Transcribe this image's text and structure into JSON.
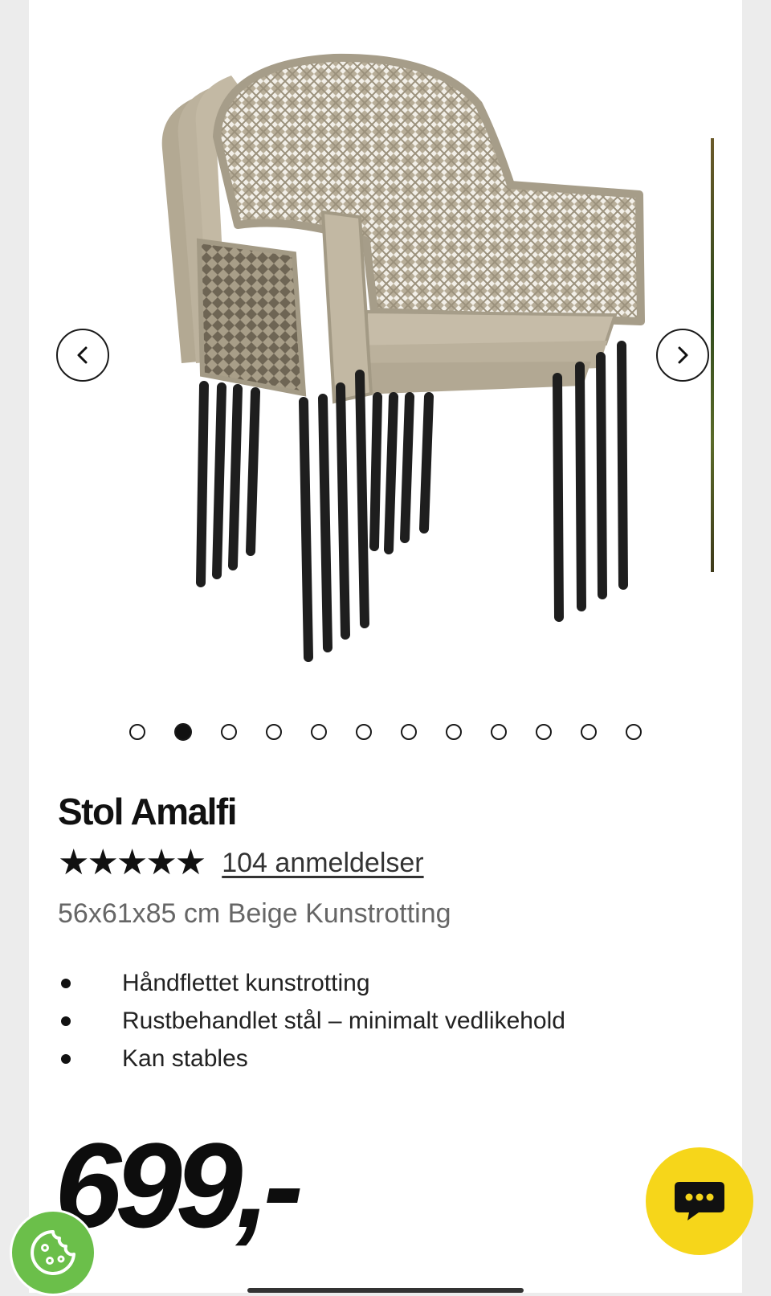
{
  "product": {
    "title": "Stol Amalfi",
    "rating_stars": "★★★★★",
    "rating_value": 5,
    "reviews_label": "104 anmeldelser",
    "subtitle": "56x61x85 cm Beige Kunstrotting",
    "features": [
      "Håndflettet kunstrotting",
      "Rustbehandlet stål – minimalt vedlikehold",
      "Kan stables"
    ],
    "price": "699,-"
  },
  "gallery": {
    "image_count": 12,
    "active_index": 2,
    "icons": {
      "prev": "chevron-left-icon",
      "next": "chevron-right-icon"
    }
  },
  "floating": {
    "chat_icon": "chat-bubble-icon",
    "cookie_icon": "cookie-icon"
  },
  "colors": {
    "accent_yellow": "#f6d61a",
    "cookie_green": "#6bbf4a",
    "text_dark": "#111111",
    "text_muted": "#666666"
  }
}
